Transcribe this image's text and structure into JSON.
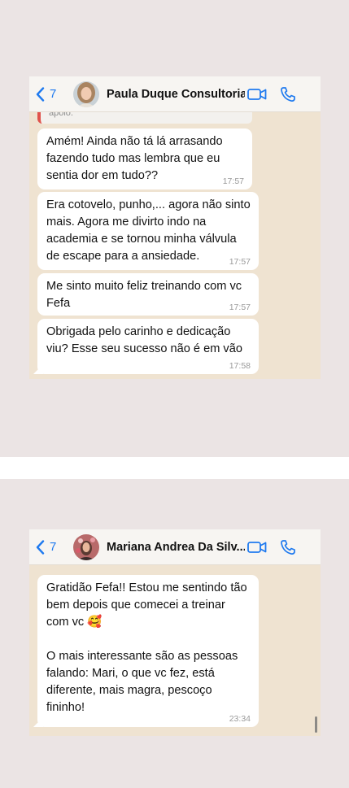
{
  "screenshots": [
    {
      "header": {
        "back_count": "7",
        "contact_name": "Paula Duque Consultoria"
      },
      "quoted_preview": "apoio.",
      "messages": [
        {
          "text": "Amém! Ainda não tá lá arrasando\nfazendo tudo mas lembra que eu\nsentia dor em tudo??",
          "time": "17:57"
        },
        {
          "text": "Era cotovelo, punho,... agora não sinto\nmais. Agora me divirto indo na\nacademia e se tornou minha válvula\nde escape para a ansiedade.",
          "time": "17:57"
        },
        {
          "text": "Me sinto muito feliz treinando com vc\nFefa",
          "time": "17:57"
        },
        {
          "text": "Obrigada pelo carinho e dedicação\nviu? Esse seu sucesso não é em vão",
          "time": "17:58"
        }
      ]
    },
    {
      "header": {
        "back_count": "7",
        "contact_name": "Mariana Andrea Da Silv..."
      },
      "messages": [
        {
          "text": "Gratidão Fefa!! Estou me sentindo tão\nbem depois que comecei a treinar\ncom vc 🥰\n\nO mais interessante são as pessoas\nfalando: Mari, o que vc fez, está\ndiferente, mais magra, pescoço\nfininho!",
          "time": "23:34"
        }
      ]
    }
  ],
  "icons": {
    "back": "chevron-left-icon",
    "video": "video-camera-icon",
    "phone": "phone-icon"
  },
  "colors": {
    "accent": "#1f7aef",
    "chat_background": "#efe3d1",
    "outer_background": "#ebe4e4",
    "bubble": "#ffffff",
    "quote_bar": "#e0524b"
  }
}
